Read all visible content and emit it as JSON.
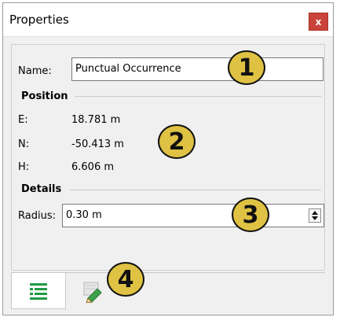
{
  "window": {
    "title": "Properties",
    "close_label": "x"
  },
  "form": {
    "name_label": "Name:",
    "name_value": "Punctual Occurrence",
    "position_section": "Position",
    "position": [
      {
        "label": "E:",
        "value": "18.781 m"
      },
      {
        "label": "N:",
        "value": "-50.413 m"
      },
      {
        "label": "H:",
        "value": "6.606 m"
      }
    ],
    "details_section": "Details",
    "radius_label": "Radius:",
    "radius_value": "0.30 m"
  },
  "callouts": [
    "1",
    "2",
    "3",
    "4"
  ],
  "tabs": [
    {
      "name": "list-view-tab",
      "icon": "list-icon",
      "active": true
    },
    {
      "name": "edit-tab",
      "icon": "pencil-icon",
      "active": false
    }
  ],
  "colors": {
    "callout": "#dfc243",
    "close": "#c9433a",
    "tab_icon_green": "#1f9a43"
  }
}
